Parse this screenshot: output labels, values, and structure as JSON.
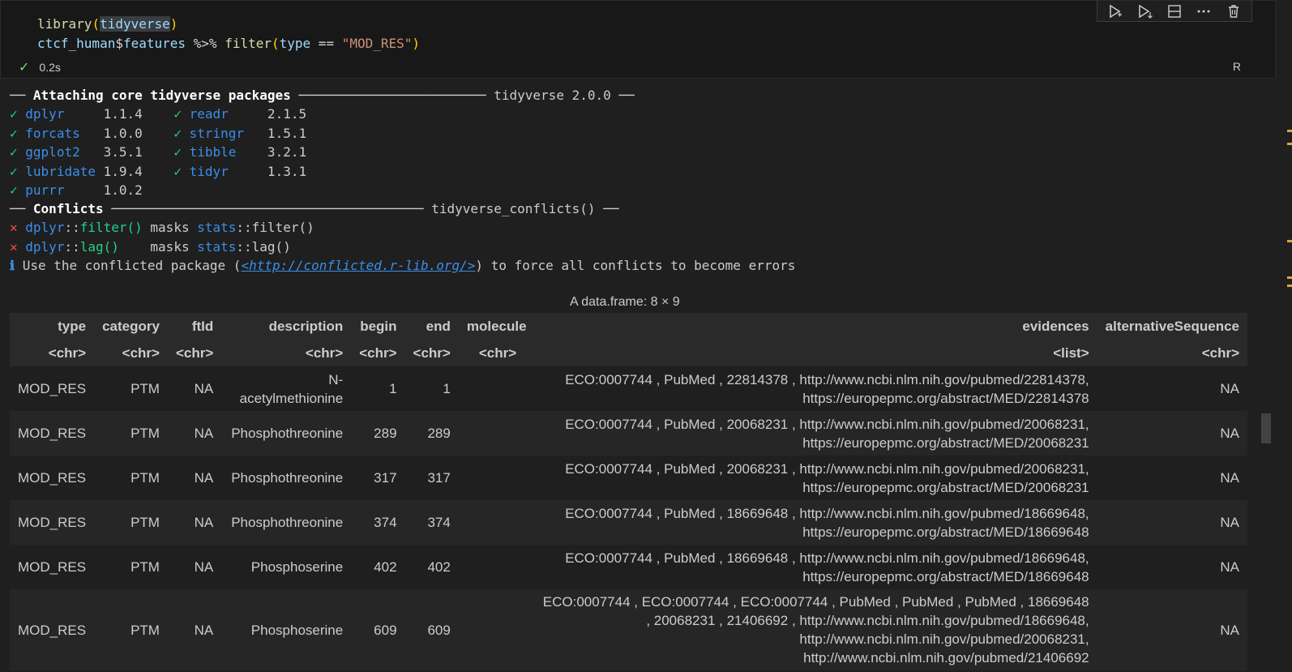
{
  "cell": {
    "line1": {
      "fn": "library",
      "open": "(",
      "arg": "tidyverse",
      "close": ")"
    },
    "line2": {
      "obj": "ctcf_human",
      "dollar": "$",
      "field": "features",
      "pipe": " %>% ",
      "fn": "filter",
      "open": "(",
      "arg": "type",
      "op": " == ",
      "str": "\"MOD_RES\"",
      "close": ")"
    },
    "status_check": "✓",
    "duration": "0.2s",
    "language": "R",
    "toolbar": {
      "run_icon": "run-by-line-icon",
      "run_below_icon": "execute-below-icon",
      "split_icon": "split-cell-icon",
      "more_icon": "more-actions-icon",
      "delete_icon": "delete-icon"
    }
  },
  "output": {
    "attach_header_left": "── ",
    "attach_header_title": "Attaching core tidyverse packages",
    "attach_header_rule": " ──────────────────────── ",
    "attach_header_right": "tidyverse 2.0.0 ──",
    "packages": [
      {
        "check": "✓",
        "name": "dplyr    ",
        "ver": " 1.1.4",
        "check2": "✓",
        "name2": "readr    ",
        "ver2": " 2.1.5"
      },
      {
        "check": "✓",
        "name": "forcats  ",
        "ver": " 1.0.0",
        "check2": "✓",
        "name2": "stringr  ",
        "ver2": " 1.5.1"
      },
      {
        "check": "✓",
        "name": "ggplot2  ",
        "ver": " 3.5.1",
        "check2": "✓",
        "name2": "tibble   ",
        "ver2": " 3.2.1"
      },
      {
        "check": "✓",
        "name": "lubridate",
        "ver": " 1.9.4",
        "check2": "✓",
        "name2": "tidyr    ",
        "ver2": " 1.3.1"
      },
      {
        "check": "✓",
        "name": "purrr    ",
        "ver": " 1.0.2",
        "check2": "",
        "name2": "",
        "ver2": ""
      }
    ],
    "conflicts_header_left": "── ",
    "conflicts_header_title": "Conflicts",
    "conflicts_header_rule": " ──────────────────────────────────────── ",
    "conflicts_header_right": "tidyverse_conflicts() ──",
    "conflicts": [
      {
        "mark": "✕",
        "pkg": "dplyr",
        "sep": "::",
        "fn": "filter()",
        "masks": " masks ",
        "pkg2": "stats",
        "sep2": "::",
        "fn2": "filter()"
      },
      {
        "mark": "✕",
        "pkg": "dplyr",
        "sep": "::",
        "fn": "lag()   ",
        "masks": " masks ",
        "pkg2": "stats",
        "sep2": "::",
        "fn2": "lag()"
      }
    ],
    "info_mark": "ℹ",
    "info_pre": " Use the conflicted package (",
    "info_link": "<http://conflicted.r-lib.org/>",
    "info_post": ") to force all conflicts to become errors"
  },
  "dataframe": {
    "caption": "A data.frame: 8 × 9",
    "columns": [
      "type",
      "category",
      "ftId",
      "description",
      "begin",
      "end",
      "molecule",
      "evidences",
      "alternativeSequence"
    ],
    "types": [
      "<chr>",
      "<chr>",
      "<chr>",
      "<chr>",
      "<chr>",
      "<chr>",
      "<chr>",
      "<list>",
      "<chr>"
    ],
    "rows": [
      [
        "MOD_RES",
        "PTM",
        "NA",
        "N-acetylmethionine",
        "1",
        "1",
        "",
        "ECO:0007744 , PubMed , 22814378 , http://www.ncbi.nlm.nih.gov/pubmed/22814378, https://europepmc.org/abstract/MED/22814378",
        "NA"
      ],
      [
        "MOD_RES",
        "PTM",
        "NA",
        "Phosphothreonine",
        "289",
        "289",
        "",
        "ECO:0007744 , PubMed , 20068231 , http://www.ncbi.nlm.nih.gov/pubmed/20068231, https://europepmc.org/abstract/MED/20068231",
        "NA"
      ],
      [
        "MOD_RES",
        "PTM",
        "NA",
        "Phosphothreonine",
        "317",
        "317",
        "",
        "ECO:0007744 , PubMed , 20068231 , http://www.ncbi.nlm.nih.gov/pubmed/20068231, https://europepmc.org/abstract/MED/20068231",
        "NA"
      ],
      [
        "MOD_RES",
        "PTM",
        "NA",
        "Phosphothreonine",
        "374",
        "374",
        "",
        "ECO:0007744 , PubMed , 18669648 , http://www.ncbi.nlm.nih.gov/pubmed/18669648, https://europepmc.org/abstract/MED/18669648",
        "NA"
      ],
      [
        "MOD_RES",
        "PTM",
        "NA",
        "Phosphoserine",
        "402",
        "402",
        "",
        "ECO:0007744 , PubMed , 18669648 , http://www.ncbi.nlm.nih.gov/pubmed/18669648, https://europepmc.org/abstract/MED/18669648",
        "NA"
      ],
      [
        "MOD_RES",
        "PTM",
        "NA",
        "Phosphoserine",
        "609",
        "609",
        "",
        "ECO:0007744 , ECO:0007744 , ECO:0007744 , PubMed , PubMed , PubMed , 18669648 , 20068231 , 21406692 , http://www.ncbi.nlm.nih.gov/pubmed/18669648, http://www.ncbi.nlm.nih.gov/pubmed/20068231, http://www.ncbi.nlm.nih.gov/pubmed/21406692",
        "NA"
      ]
    ]
  },
  "colors": {
    "background": "#1f1f1f",
    "cell_background": "#181818",
    "check_green": "#23d18b",
    "error_red": "#f14c4c",
    "link_blue": "#3b8eea"
  }
}
